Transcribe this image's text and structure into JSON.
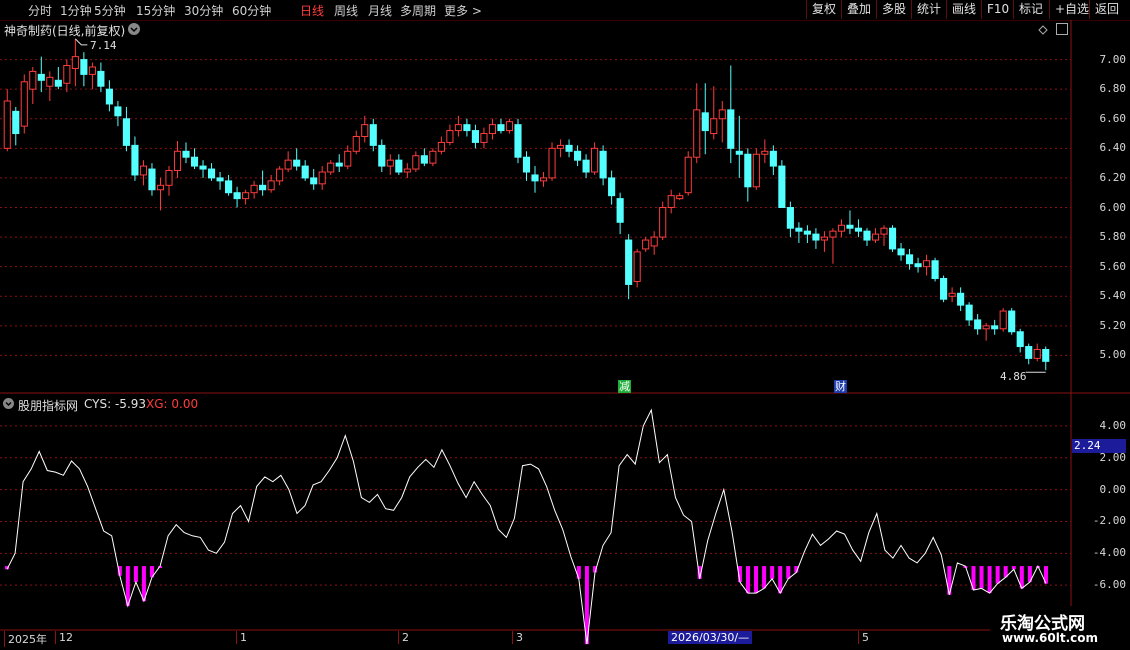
{
  "toolbar": {
    "periods": [
      "分时",
      "1分钟",
      "5分钟",
      "15分钟",
      "30分钟",
      "60分钟",
      "日线",
      "周线",
      "月线",
      "多周期",
      "更多 >"
    ],
    "active_period": "日线",
    "buttons": [
      "复权",
      "叠加",
      "多股",
      "统计",
      "画线",
      "F10",
      "标记",
      "+自选",
      "返回"
    ]
  },
  "main_panel": {
    "title": "神奇制药(日线,前复权)",
    "high_label": "7.14",
    "low_label": "4.86",
    "y_ticks": [
      "7.00",
      "6.80",
      "6.60",
      "6.40",
      "6.20",
      "6.00",
      "5.80",
      "5.60",
      "5.40",
      "5.20",
      "5.00"
    ],
    "events": [
      {
        "label": "减",
        "color": "#1fae3a"
      },
      {
        "label": "财",
        "color": "#1f3cae"
      }
    ]
  },
  "indicator_panel": {
    "title": "股朋指标网",
    "cys_label": "CYS: -5.93",
    "xg_label": "XG: 0.00",
    "y_ticks": [
      "4.00",
      "2.00",
      "0.00",
      "-2.00",
      "-4.00",
      "-6.00"
    ],
    "current_value": "2.24"
  },
  "x_axis": {
    "labels": [
      "2025年",
      "12",
      "1",
      "2",
      "3",
      "2026/03/30/—",
      "5"
    ]
  },
  "watermark": {
    "title": "乐淘公式网",
    "url": "www.60lt.com"
  },
  "colors": {
    "up": "#ff3c3c",
    "down": "#54ffff",
    "grid": "#8a1212",
    "signal": "#ff00ff",
    "line": "#ffffff"
  },
  "chart_data": [
    {
      "type": "candlestick",
      "title": "神奇制药(日线,前复权)",
      "ylim": [
        4.8,
        7.2
      ],
      "ohlc": [
        [
          6.4,
          6.8,
          6.38,
          6.72
        ],
        [
          6.65,
          6.68,
          6.42,
          6.5
        ],
        [
          6.55,
          6.9,
          6.5,
          6.85
        ],
        [
          6.8,
          6.95,
          6.7,
          6.92
        ],
        [
          6.9,
          7.02,
          6.78,
          6.86
        ],
        [
          6.82,
          6.92,
          6.72,
          6.88
        ],
        [
          6.86,
          6.95,
          6.8,
          6.82
        ],
        [
          6.84,
          7.0,
          6.78,
          6.96
        ],
        [
          6.94,
          7.14,
          6.82,
          7.02
        ],
        [
          7.0,
          7.05,
          6.82,
          6.9
        ],
        [
          6.9,
          6.98,
          6.8,
          6.95
        ],
        [
          6.92,
          6.98,
          6.78,
          6.82
        ],
        [
          6.8,
          6.86,
          6.65,
          6.7
        ],
        [
          6.68,
          6.72,
          6.55,
          6.62
        ],
        [
          6.6,
          6.68,
          6.38,
          6.42
        ],
        [
          6.42,
          6.48,
          6.18,
          6.22
        ],
        [
          6.22,
          6.32,
          6.15,
          6.28
        ],
        [
          6.26,
          6.3,
          6.08,
          6.12
        ],
        [
          6.12,
          6.2,
          5.98,
          6.15
        ],
        [
          6.15,
          6.28,
          6.08,
          6.25
        ],
        [
          6.25,
          6.45,
          6.2,
          6.38
        ],
        [
          6.38,
          6.44,
          6.3,
          6.34
        ],
        [
          6.34,
          6.4,
          6.26,
          6.28
        ],
        [
          6.28,
          6.32,
          6.2,
          6.26
        ],
        [
          6.26,
          6.3,
          6.18,
          6.2
        ],
        [
          6.2,
          6.24,
          6.12,
          6.18
        ],
        [
          6.18,
          6.22,
          6.08,
          6.1
        ],
        [
          6.1,
          6.14,
          6.0,
          6.06
        ],
        [
          6.06,
          6.12,
          6.02,
          6.1
        ],
        [
          6.1,
          6.18,
          6.06,
          6.15
        ],
        [
          6.15,
          6.25,
          6.08,
          6.12
        ],
        [
          6.12,
          6.22,
          6.1,
          6.18
        ],
        [
          6.18,
          6.28,
          6.15,
          6.26
        ],
        [
          6.26,
          6.38,
          6.24,
          6.32
        ],
        [
          6.32,
          6.4,
          6.25,
          6.28
        ],
        [
          6.28,
          6.32,
          6.18,
          6.2
        ],
        [
          6.2,
          6.26,
          6.12,
          6.16
        ],
        [
          6.16,
          6.28,
          6.12,
          6.24
        ],
        [
          6.24,
          6.32,
          6.22,
          6.3
        ],
        [
          6.3,
          6.36,
          6.24,
          6.28
        ],
        [
          6.28,
          6.42,
          6.26,
          6.38
        ],
        [
          6.38,
          6.52,
          6.36,
          6.48
        ],
        [
          6.48,
          6.62,
          6.44,
          6.56
        ],
        [
          6.56,
          6.6,
          6.38,
          6.42
        ],
        [
          6.42,
          6.46,
          6.24,
          6.28
        ],
        [
          6.28,
          6.36,
          6.22,
          6.32
        ],
        [
          6.32,
          6.36,
          6.22,
          6.24
        ],
        [
          6.24,
          6.3,
          6.2,
          6.26
        ],
        [
          6.26,
          6.38,
          6.24,
          6.35
        ],
        [
          6.35,
          6.4,
          6.28,
          6.3
        ],
        [
          6.3,
          6.4,
          6.28,
          6.38
        ],
        [
          6.38,
          6.48,
          6.36,
          6.44
        ],
        [
          6.44,
          6.56,
          6.42,
          6.52
        ],
        [
          6.52,
          6.62,
          6.48,
          6.56
        ],
        [
          6.56,
          6.6,
          6.48,
          6.52
        ],
        [
          6.52,
          6.56,
          6.4,
          6.44
        ],
        [
          6.44,
          6.54,
          6.4,
          6.5
        ],
        [
          6.5,
          6.6,
          6.46,
          6.56
        ],
        [
          6.56,
          6.6,
          6.5,
          6.52
        ],
        [
          6.52,
          6.6,
          6.5,
          6.58
        ],
        [
          6.56,
          6.6,
          6.3,
          6.34
        ],
        [
          6.34,
          6.38,
          6.18,
          6.24
        ],
        [
          6.22,
          6.28,
          6.1,
          6.18
        ],
        [
          6.18,
          6.24,
          6.14,
          6.2
        ],
        [
          6.2,
          6.44,
          6.18,
          6.4
        ],
        [
          6.4,
          6.46,
          6.34,
          6.42
        ],
        [
          6.42,
          6.46,
          6.34,
          6.38
        ],
        [
          6.38,
          6.42,
          6.28,
          6.32
        ],
        [
          6.32,
          6.36,
          6.2,
          6.24
        ],
        [
          6.24,
          6.44,
          6.22,
          6.4
        ],
        [
          6.38,
          6.42,
          6.15,
          6.2
        ],
        [
          6.2,
          6.25,
          6.02,
          6.08
        ],
        [
          6.06,
          6.1,
          5.82,
          5.9
        ],
        [
          5.78,
          5.82,
          5.38,
          5.48
        ],
        [
          5.5,
          5.72,
          5.46,
          5.7
        ],
        [
          5.72,
          5.8,
          5.7,
          5.78
        ],
        [
          5.74,
          5.84,
          5.68,
          5.8
        ],
        [
          5.8,
          6.04,
          5.78,
          6.0
        ],
        [
          6.0,
          6.12,
          5.96,
          6.08
        ],
        [
          6.06,
          6.1,
          6.05,
          6.08
        ],
        [
          6.1,
          6.38,
          6.08,
          6.34
        ],
        [
          6.34,
          6.84,
          6.3,
          6.66
        ],
        [
          6.64,
          6.84,
          6.36,
          6.52
        ],
        [
          6.5,
          6.82,
          6.46,
          6.6
        ],
        [
          6.6,
          6.72,
          6.44,
          6.66
        ],
        [
          6.66,
          6.96,
          6.3,
          6.4
        ],
        [
          6.38,
          6.62,
          6.2,
          6.36
        ],
        [
          6.36,
          6.4,
          6.04,
          6.14
        ],
        [
          6.14,
          6.4,
          6.12,
          6.36
        ],
        [
          6.36,
          6.46,
          6.3,
          6.38
        ],
        [
          6.38,
          6.42,
          6.22,
          6.28
        ],
        [
          6.28,
          6.32,
          6.04,
          6.0
        ],
        [
          6.0,
          6.04,
          5.8,
          5.86
        ],
        [
          5.86,
          5.9,
          5.76,
          5.84
        ],
        [
          5.84,
          5.88,
          5.76,
          5.82
        ],
        [
          5.82,
          5.86,
          5.72,
          5.78
        ],
        [
          5.78,
          5.84,
          5.7,
          5.8
        ],
        [
          5.8,
          5.86,
          5.62,
          5.84
        ],
        [
          5.84,
          5.92,
          5.8,
          5.88
        ],
        [
          5.88,
          5.98,
          5.82,
          5.86
        ],
        [
          5.86,
          5.92,
          5.8,
          5.84
        ],
        [
          5.84,
          5.86,
          5.74,
          5.78
        ],
        [
          5.78,
          5.86,
          5.76,
          5.82
        ],
        [
          5.82,
          5.88,
          5.74,
          5.86
        ],
        [
          5.86,
          5.88,
          5.7,
          5.72
        ],
        [
          5.72,
          5.76,
          5.64,
          5.68
        ],
        [
          5.68,
          5.72,
          5.58,
          5.62
        ],
        [
          5.62,
          5.66,
          5.56,
          5.6
        ],
        [
          5.6,
          5.68,
          5.54,
          5.64
        ],
        [
          5.64,
          5.66,
          5.5,
          5.52
        ],
        [
          5.52,
          5.54,
          5.36,
          5.38
        ],
        [
          5.4,
          5.46,
          5.36,
          5.42
        ],
        [
          5.42,
          5.46,
          5.3,
          5.34
        ],
        [
          5.34,
          5.36,
          5.2,
          5.24
        ],
        [
          5.24,
          5.28,
          5.14,
          5.18
        ],
        [
          5.18,
          5.22,
          5.1,
          5.2
        ],
        [
          5.2,
          5.24,
          5.14,
          5.18
        ],
        [
          5.18,
          5.32,
          5.16,
          5.3
        ],
        [
          5.3,
          5.32,
          5.14,
          5.16
        ],
        [
          5.16,
          5.18,
          5.02,
          5.06
        ],
        [
          5.06,
          5.08,
          4.94,
          4.98
        ],
        [
          4.98,
          5.08,
          4.96,
          5.04
        ],
        [
          5.04,
          5.06,
          4.9,
          4.96
        ]
      ]
    },
    {
      "type": "line",
      "title": "股朋指标网",
      "ylim": [
        -8.5,
        5
      ],
      "series": [
        {
          "name": "CYS",
          "values": [
            -5.0,
            -4.0,
            0.5,
            1.3,
            2.4,
            1.2,
            1.1,
            0.9,
            1.8,
            1.3,
            0.2,
            -1.2,
            -2.6,
            -2.9,
            -5.4,
            -7.3,
            -5.8,
            -7.0,
            -5.5,
            -4.8,
            -2.9,
            -2.2,
            -2.7,
            -2.9,
            -3.0,
            -3.8,
            -4.0,
            -3.3,
            -1.5,
            -1.0,
            -2.0,
            0.2,
            0.8,
            0.5,
            0.9,
            0.0,
            -1.5,
            -1.0,
            0.3,
            0.5,
            1.2,
            2.0,
            3.4,
            1.8,
            -0.5,
            -0.8,
            -0.3,
            -1.2,
            -1.3,
            -0.5,
            0.8,
            1.4,
            1.9,
            1.4,
            2.5,
            1.5,
            0.4,
            -0.5,
            0.5,
            -0.3,
            -1.0,
            -2.5,
            -3.0,
            -1.8,
            1.5,
            1.6,
            1.3,
            0.2,
            -1.3,
            -2.5,
            -4.2,
            -5.6,
            -9.7,
            -5.2,
            -3.5,
            -2.7,
            1.5,
            2.2,
            1.6,
            4.0,
            5.0,
            1.7,
            2.2,
            -0.5,
            -1.6,
            -2.0,
            -5.6,
            -3.2,
            -1.5,
            0.0,
            -2.6,
            -5.8,
            -6.5,
            -6.5,
            -6.2,
            -5.6,
            -6.5,
            -5.6,
            -5.2,
            -3.9,
            -2.8,
            -3.5,
            -3.1,
            -2.6,
            -2.8,
            -3.8,
            -4.5,
            -2.7,
            -1.5,
            -3.8,
            -4.3,
            -3.5,
            -4.3,
            -4.6,
            -4.0,
            -3.0,
            -4.1,
            -6.6,
            -4.6,
            -4.8,
            -6.3,
            -6.2,
            -6.5,
            -5.9,
            -5.5,
            -5.0,
            -6.2,
            -5.8,
            -4.8,
            -5.9
          ]
        }
      ]
    }
  ]
}
